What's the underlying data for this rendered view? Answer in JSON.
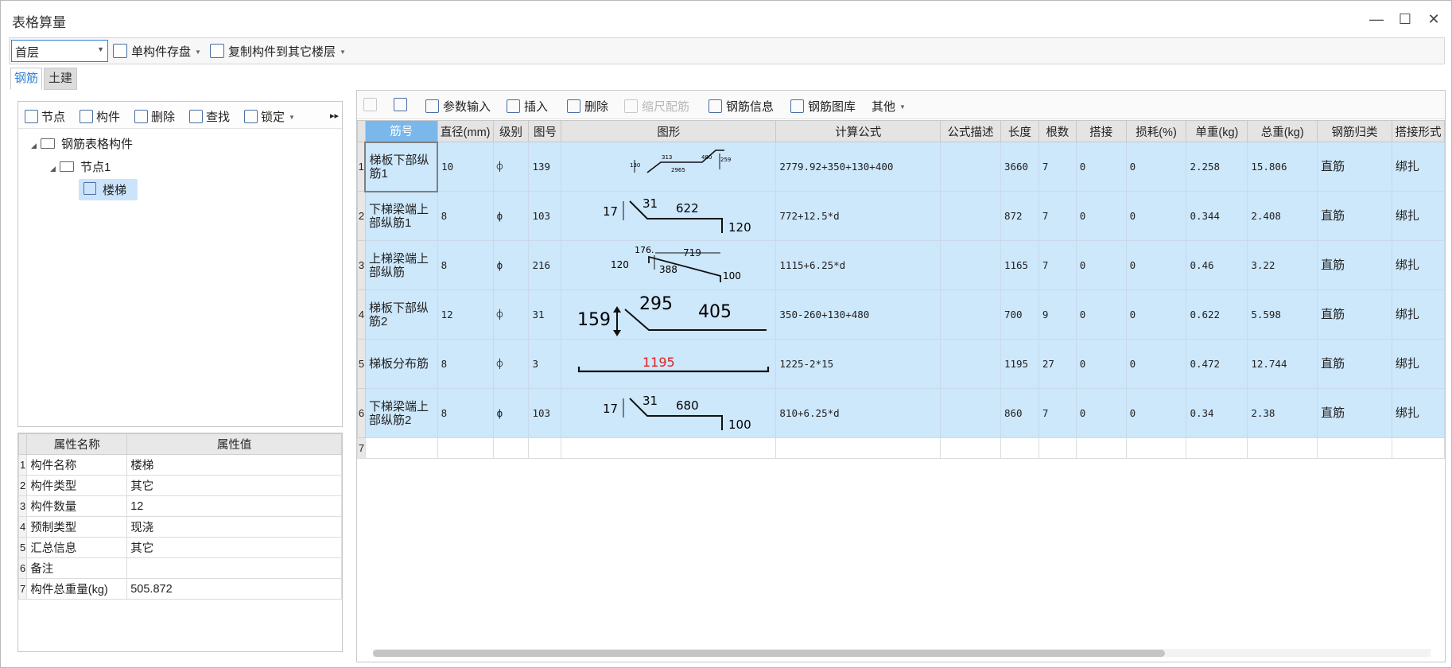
{
  "window": {
    "title": "表格算量",
    "controls": [
      "—",
      "☐",
      "✕"
    ]
  },
  "topbar": {
    "floor": "首层",
    "save_label": "单构件存盘",
    "copy_label": "复制构件到其它楼层"
  },
  "tabs": [
    "钢筋",
    "土建"
  ],
  "tree_toolbar": {
    "node": "节点",
    "component": "构件",
    "delete": "删除",
    "find": "查找",
    "lock": "锁定",
    "more": "▸▸"
  },
  "tree": {
    "root": "钢筋表格构件",
    "child": "节点1",
    "leaf": "楼梯"
  },
  "properties": {
    "headers": [
      "属性名称",
      "属性值"
    ],
    "rows": [
      {
        "n": "1",
        "name": "构件名称",
        "value": "楼梯"
      },
      {
        "n": "2",
        "name": "构件类型",
        "value": "其它"
      },
      {
        "n": "3",
        "name": "构件数量",
        "value": "12"
      },
      {
        "n": "4",
        "name": "预制类型",
        "value": "现浇"
      },
      {
        "n": "5",
        "name": "汇总信息",
        "value": "其它"
      },
      {
        "n": "6",
        "name": "备注",
        "value": ""
      },
      {
        "n": "7",
        "name": "构件总重量(kg)",
        "value": "505.872"
      }
    ]
  },
  "rebar_toolbar": {
    "params": "参数输入",
    "insert": "插入",
    "delete": "删除",
    "scale": "缩尺配筋",
    "info": "钢筋信息",
    "library": "钢筋图库",
    "other": "其他"
  },
  "grid": {
    "headers": [
      "筋号",
      "直径(mm)",
      "级别",
      "图号",
      "图形",
      "计算公式",
      "公式描述",
      "长度",
      "根数",
      "搭接",
      "损耗(%)",
      "单重(kg)",
      "总重(kg)",
      "钢筋归类",
      "搭接形式"
    ],
    "rows": [
      {
        "n": "1",
        "name": "梯板下部纵筋1",
        "dia": "10",
        "grade": "⌽",
        "fig": "139",
        "formula": "2779.92+350+130+400",
        "desc": "",
        "length": "3660",
        "count": "7",
        "lap": "0",
        "loss": "0",
        "unit_w": "2.258",
        "total_w": "15.806",
        "category": "直筋",
        "lap_type": "绑扎",
        "shape": {
          "a": "130",
          "b": "313",
          "c": "2965",
          "d": "480",
          "e": "259"
        }
      },
      {
        "n": "2",
        "name": "下梯梁端上部纵筋1",
        "dia": "8",
        "grade": "ф",
        "fig": "103",
        "formula": "772+12.5*d",
        "desc": "",
        "length": "872",
        "count": "7",
        "lap": "0",
        "loss": "0",
        "unit_w": "0.344",
        "total_w": "2.408",
        "category": "直筋",
        "lap_type": "绑扎",
        "shape": {
          "a": "17",
          "b": "31",
          "c": "622",
          "d": "120"
        }
      },
      {
        "n": "3",
        "name": "上梯梁端上部纵筋",
        "dia": "8",
        "grade": "ф",
        "fig": "216",
        "formula": "1115+6.25*d",
        "desc": "",
        "length": "1165",
        "count": "7",
        "lap": "0",
        "loss": "0",
        "unit_w": "0.46",
        "total_w": "3.22",
        "category": "直筋",
        "lap_type": "绑扎",
        "shape": {
          "a": "176.",
          "b": "719",
          "c": "120",
          "d": "388",
          "e": "100"
        }
      },
      {
        "n": "4",
        "name": "梯板下部纵筋2",
        "dia": "12",
        "grade": "⌽",
        "fig": "31",
        "formula": "350-260+130+480",
        "desc": "",
        "length": "700",
        "count": "9",
        "lap": "0",
        "loss": "0",
        "unit_w": "0.622",
        "total_w": "5.598",
        "category": "直筋",
        "lap_type": "绑扎",
        "shape": {
          "a": "159",
          "b": "295",
          "c": "405"
        }
      },
      {
        "n": "5",
        "name": "梯板分布筋",
        "dia": "8",
        "grade": "⌽",
        "fig": "3",
        "formula": "1225-2*15",
        "desc": "",
        "length": "1195",
        "count": "27",
        "lap": "0",
        "loss": "0",
        "unit_w": "0.472",
        "total_w": "12.744",
        "category": "直筋",
        "lap_type": "绑扎",
        "shape": {
          "a": "1195"
        }
      },
      {
        "n": "6",
        "name": "下梯梁端上部纵筋2",
        "dia": "8",
        "grade": "ф",
        "fig": "103",
        "formula": "810+6.25*d",
        "desc": "",
        "length": "860",
        "count": "7",
        "lap": "0",
        "loss": "0",
        "unit_w": "0.34",
        "total_w": "2.38",
        "category": "直筋",
        "lap_type": "绑扎",
        "shape": {
          "a": "17",
          "b": "31",
          "c": "680",
          "d": "100"
        }
      }
    ],
    "empty_row": "7"
  },
  "colors": {
    "accent": "#2f7fd6",
    "row_selected": "#cde7fb",
    "header_active": "#7ab7ea",
    "shape_highlight": "#e02020"
  }
}
